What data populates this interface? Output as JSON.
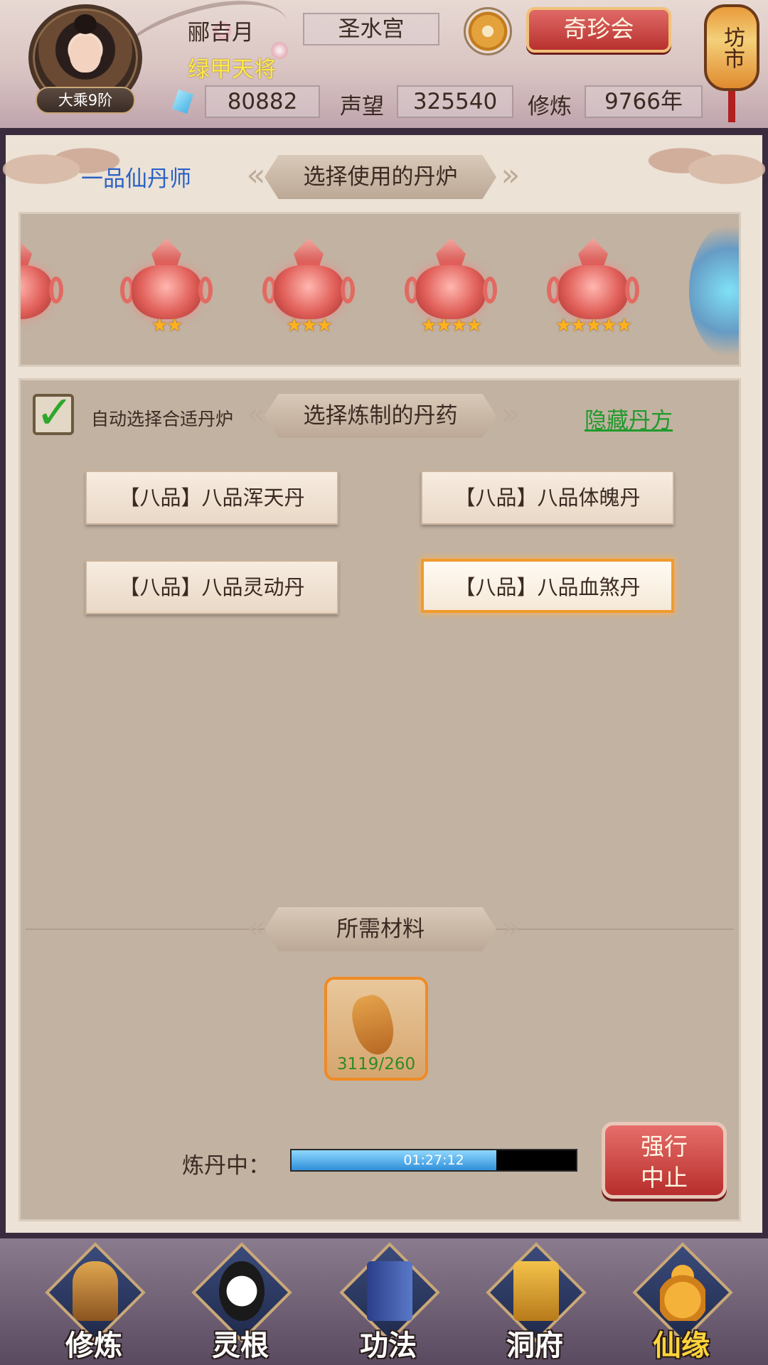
{
  "header": {
    "rank_badge": "大乘9阶",
    "player_name": "郦吉月",
    "player_title": "绿甲天将",
    "sect": "圣水宫",
    "treasure_button": "奇珍会",
    "market_lantern": "坊市",
    "spirit_stones": "80882",
    "reputation_label": "声望",
    "reputation_value": "325540",
    "cultivation_label": "修炼",
    "cultivation_value": "9766年"
  },
  "panel": {
    "alchemist_rank": "一品仙丹师",
    "furnace_banner": "选择使用的丹炉",
    "furnaces": [
      {
        "stars": ""
      },
      {
        "stars": "★★"
      },
      {
        "stars": "★★★"
      },
      {
        "stars": "★★★★"
      },
      {
        "stars": "★★★★★"
      }
    ],
    "auto_select_label": "自动选择合适丹炉",
    "auto_select_checked": true,
    "recipe_banner": "选择炼制的丹药",
    "hide_recipes_link": "隐藏丹方",
    "recipes": [
      {
        "label": "【八品】八品浑天丹",
        "selected": false
      },
      {
        "label": "【八品】八品体魄丹",
        "selected": false
      },
      {
        "label": "【八品】八品灵动丹",
        "selected": false
      },
      {
        "label": "【八品】八品血煞丹",
        "selected": true
      }
    ],
    "materials_banner": "所需材料",
    "material": {
      "icon": "ginseng-icon",
      "count": "3119/260"
    },
    "progress_label": "炼丹中：",
    "progress_time": "01:27:12",
    "progress_fraction": 0.72,
    "force_stop_line1": "强行",
    "force_stop_line2": "中止"
  },
  "nav": {
    "items": [
      {
        "label": "修炼",
        "active": false
      },
      {
        "label": "灵根",
        "active": false
      },
      {
        "label": "功法",
        "active": false
      },
      {
        "label": "洞府",
        "active": false
      },
      {
        "label": "仙缘",
        "active": true
      }
    ]
  },
  "colors": {
    "accent_orange": "#f29a2e",
    "link_green": "#1f9a2a",
    "alchemist_blue": "#2a62c4",
    "title_yellow": "#ffe94a",
    "stop_red": "#b72e2c"
  }
}
